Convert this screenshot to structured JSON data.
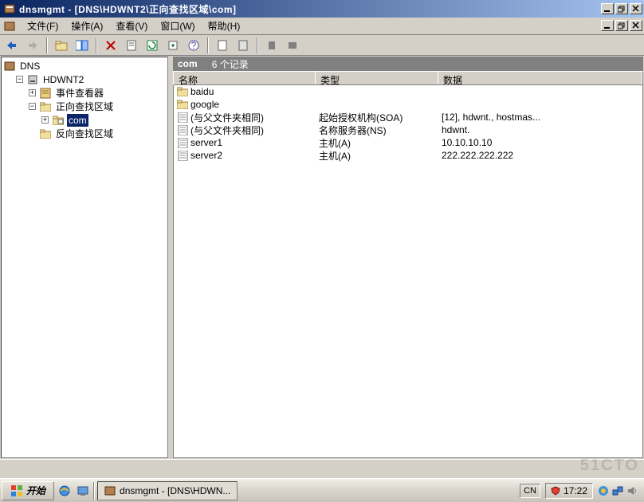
{
  "window": {
    "title": "dnsmgmt - [DNS\\HDWNT2\\正向查找区域\\com]"
  },
  "menus": {
    "file": "文件(F)",
    "action": "操作(A)",
    "view": "查看(V)",
    "window": "窗口(W)",
    "help": "帮助(H)"
  },
  "tree": {
    "root": "DNS",
    "server": "HDWNT2",
    "eventviewer": "事件查看器",
    "forward": "正向查找区域",
    "com": "com",
    "reverse": "反向查找区域"
  },
  "path": {
    "zone": "com",
    "count": "6 个记录"
  },
  "columns": {
    "name": "名称",
    "type": "类型",
    "data": "数据"
  },
  "rows": [
    {
      "icon": "folder",
      "name": "baidu",
      "type": "",
      "data": ""
    },
    {
      "icon": "folder",
      "name": "google",
      "type": "",
      "data": ""
    },
    {
      "icon": "record",
      "name": "(与父文件夹相同)",
      "type": "起始授权机构(SOA)",
      "data": "[12], hdwnt., hostmas..."
    },
    {
      "icon": "record",
      "name": "(与父文件夹相同)",
      "type": "名称服务器(NS)",
      "data": "hdwnt."
    },
    {
      "icon": "record",
      "name": "server1",
      "type": "主机(A)",
      "data": "10.10.10.10"
    },
    {
      "icon": "record",
      "name": "server2",
      "type": "主机(A)",
      "data": "222.222.222.222"
    }
  ],
  "taskbar": {
    "start": "开始",
    "task": "dnsmgmt - [DNS\\HDWN...",
    "lang": "CN",
    "time": "17:22"
  }
}
